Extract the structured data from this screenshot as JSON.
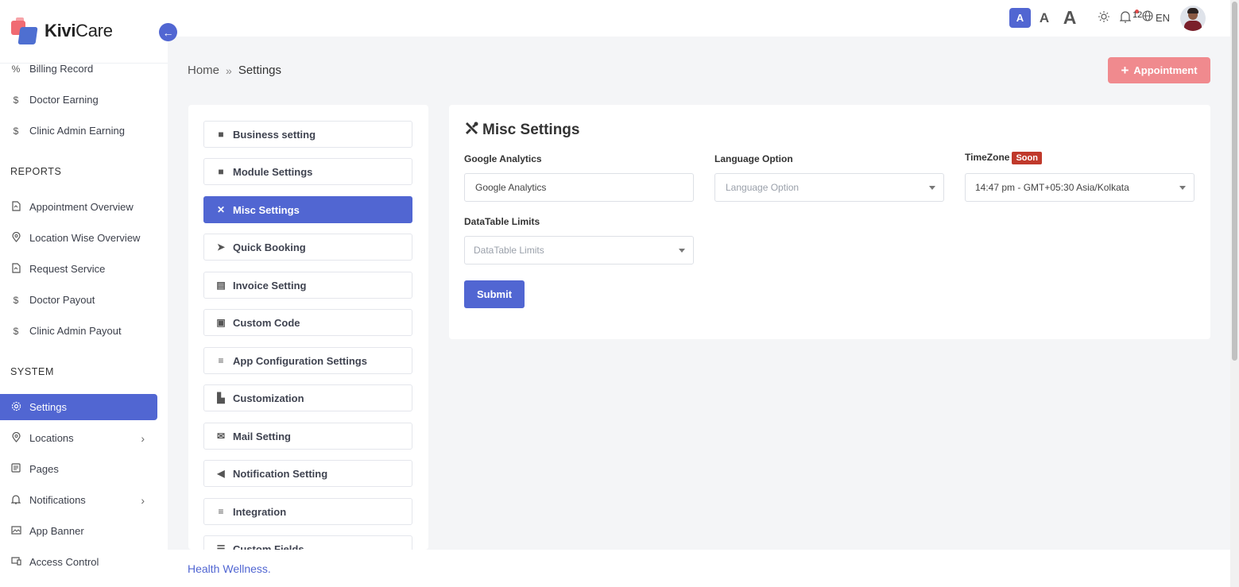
{
  "app": {
    "brand_bold": "Kivi",
    "brand_regular": "Care",
    "collapse_icon": "arrow-left-icon"
  },
  "sidebar": {
    "items_top": [
      {
        "label": "Billing Record",
        "icon": "percent-icon"
      },
      {
        "label": "Doctor Earning",
        "icon": "dollar-icon"
      },
      {
        "label": "Clinic Admin Earning",
        "icon": "dollar-icon"
      }
    ],
    "reports_heading": "REPORTS",
    "reports": [
      {
        "label": "Appointment Overview",
        "icon": "report-icon"
      },
      {
        "label": "Location Wise Overview",
        "icon": "location-pin-icon"
      },
      {
        "label": "Request Service",
        "icon": "report-icon"
      },
      {
        "label": "Doctor Payout",
        "icon": "dollar-icon"
      },
      {
        "label": "Clinic Admin Payout",
        "icon": "dollar-icon"
      }
    ],
    "system_heading": "SYSTEM",
    "system": [
      {
        "label": "Settings",
        "icon": "gear-icon",
        "active": true
      },
      {
        "label": "Locations",
        "icon": "location-pin-icon",
        "expandable": true
      },
      {
        "label": "Pages",
        "icon": "page-icon"
      },
      {
        "label": "Notifications",
        "icon": "bell-icon",
        "expandable": true
      },
      {
        "label": "App Banner",
        "icon": "image-icon"
      },
      {
        "label": "Access Control",
        "icon": "devices-icon"
      }
    ]
  },
  "topbar": {
    "font_sizes": [
      "A",
      "A",
      "A"
    ],
    "notification_count": "12",
    "language": "EN"
  },
  "breadcrumb": {
    "home": "Home",
    "current": "Settings"
  },
  "appointment_button": "Appointment",
  "settings_menu": [
    {
      "label": "Business setting",
      "icon": "box-icon"
    },
    {
      "label": "Module Settings",
      "icon": "box-icon"
    },
    {
      "label": "Misc Settings",
      "icon": "tools-icon",
      "active": true
    },
    {
      "label": "Quick Booking",
      "icon": "paper-plane-icon"
    },
    {
      "label": "Invoice Setting",
      "icon": "file-icon"
    },
    {
      "label": "Custom Code",
      "icon": "file-code-icon"
    },
    {
      "label": "App Configuration Settings",
      "icon": "sliders-icon"
    },
    {
      "label": "Customization",
      "icon": "palette-icon"
    },
    {
      "label": "Mail Setting",
      "icon": "envelope-icon"
    },
    {
      "label": "Notification Setting",
      "icon": "megaphone-icon"
    },
    {
      "label": "Integration",
      "icon": "sliders-icon"
    },
    {
      "label": "Custom Fields",
      "icon": "list-icon"
    }
  ],
  "misc": {
    "title": "Misc Settings",
    "google_analytics_label": "Google Analytics",
    "google_analytics_value": "Google Analytics",
    "language_label": "Language Option",
    "language_placeholder": "Language Option",
    "timezone_label": "TimeZone",
    "timezone_badge": "Soon",
    "timezone_value": "14:47 pm - GMT+05:30 Asia/Kolkata",
    "datatable_label": "DataTable Limits",
    "datatable_placeholder": "DataTable Limits",
    "submit_label": "Submit"
  },
  "footer": {
    "text": "Health Wellness."
  },
  "colors": {
    "primary": "#5166d2",
    "appointment": "#f08a8e",
    "soon_badge": "#c0392b"
  }
}
